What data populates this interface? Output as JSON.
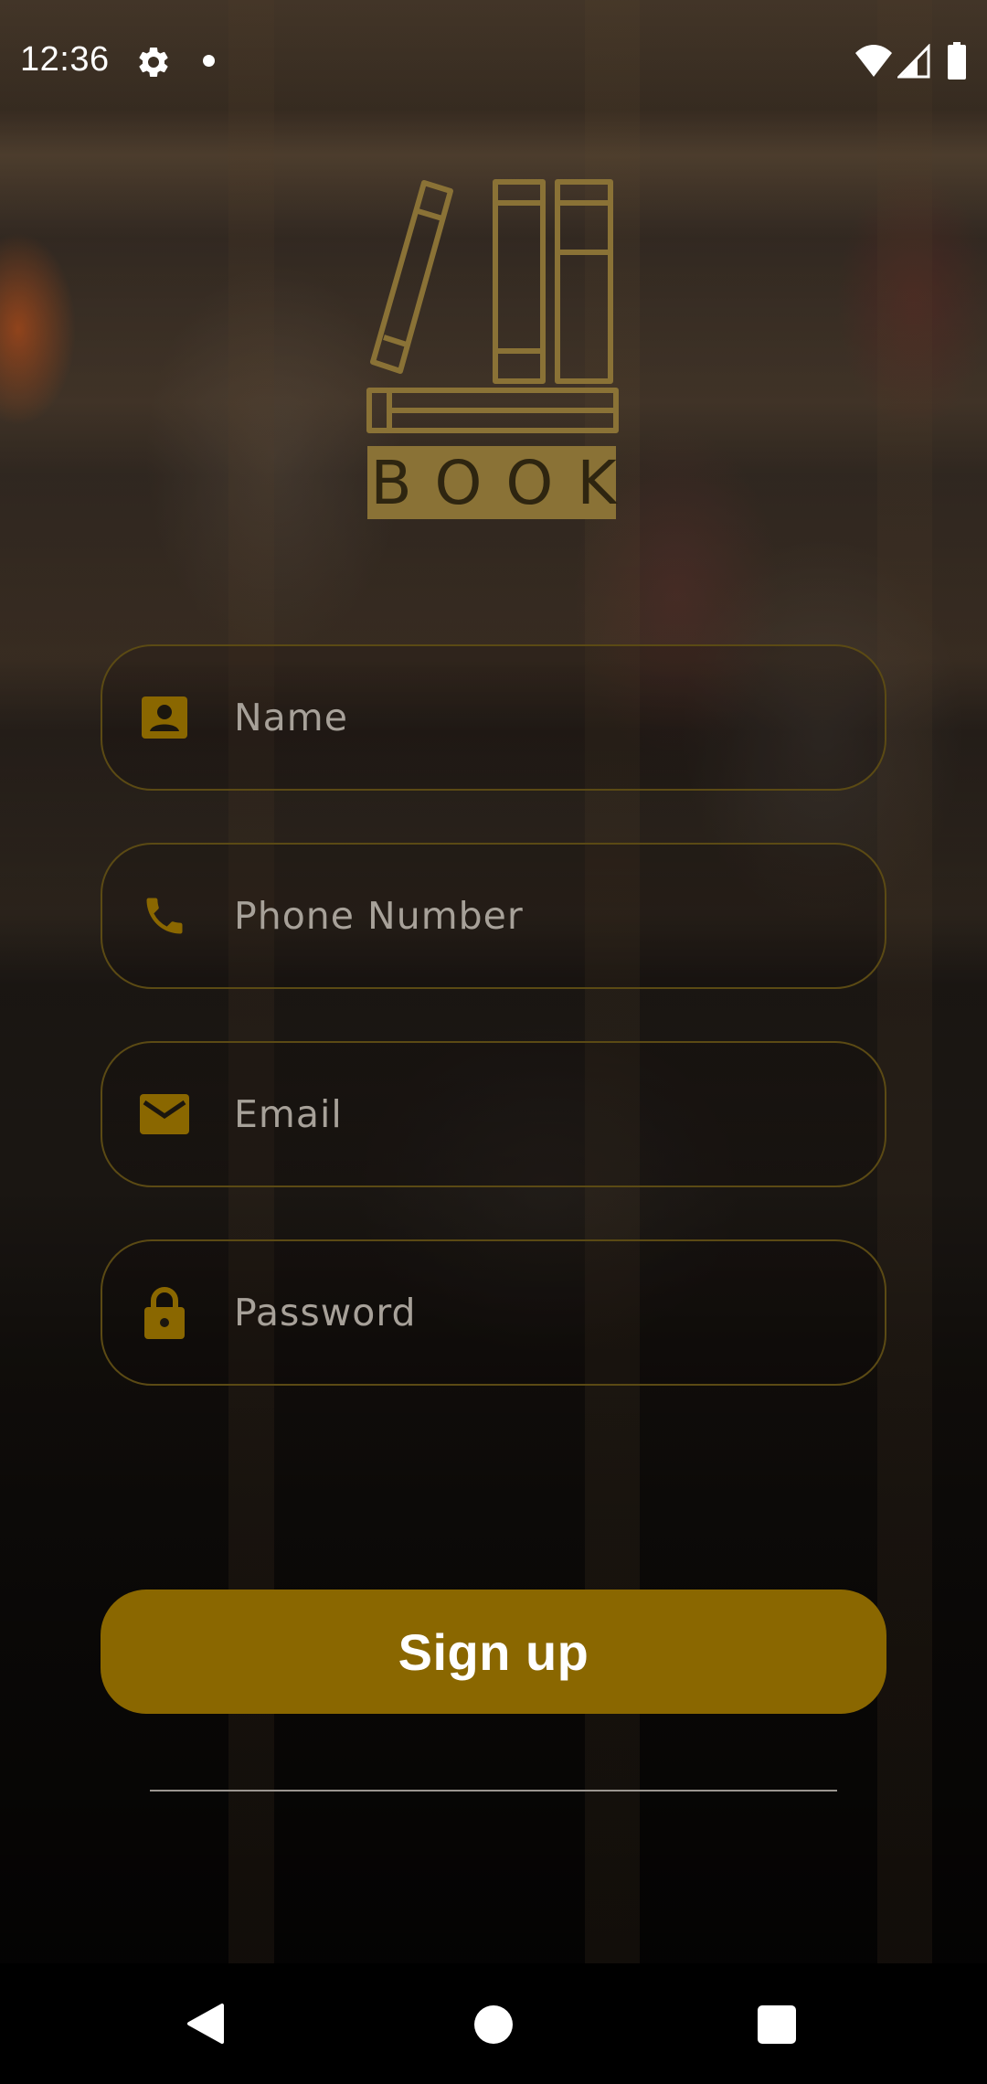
{
  "status_bar": {
    "time": "12:36",
    "icons": [
      "gear-icon",
      "notification-dot",
      "wifi-icon",
      "cell-signal-icon",
      "battery-icon"
    ]
  },
  "logo": {
    "text": "BOOK",
    "icon": "books-logo",
    "color": "#8a7236"
  },
  "form": {
    "fields": [
      {
        "placeholder": "Name",
        "icon": "contact-card-icon",
        "type": "text",
        "value": ""
      },
      {
        "placeholder": "Phone Number",
        "icon": "phone-icon",
        "type": "tel",
        "value": ""
      },
      {
        "placeholder": "Email",
        "icon": "mail-icon",
        "type": "email",
        "value": ""
      },
      {
        "placeholder": "Password",
        "icon": "lock-icon",
        "type": "password",
        "value": ""
      }
    ],
    "submit_label": "Sign up"
  },
  "colors": {
    "accent": "#8a6700",
    "field_border": "#5b4a14",
    "icon": "#8a6700",
    "placeholder": "#a7a199"
  },
  "nav_bar": {
    "buttons": [
      "back-icon",
      "home-icon",
      "recents-icon"
    ]
  }
}
